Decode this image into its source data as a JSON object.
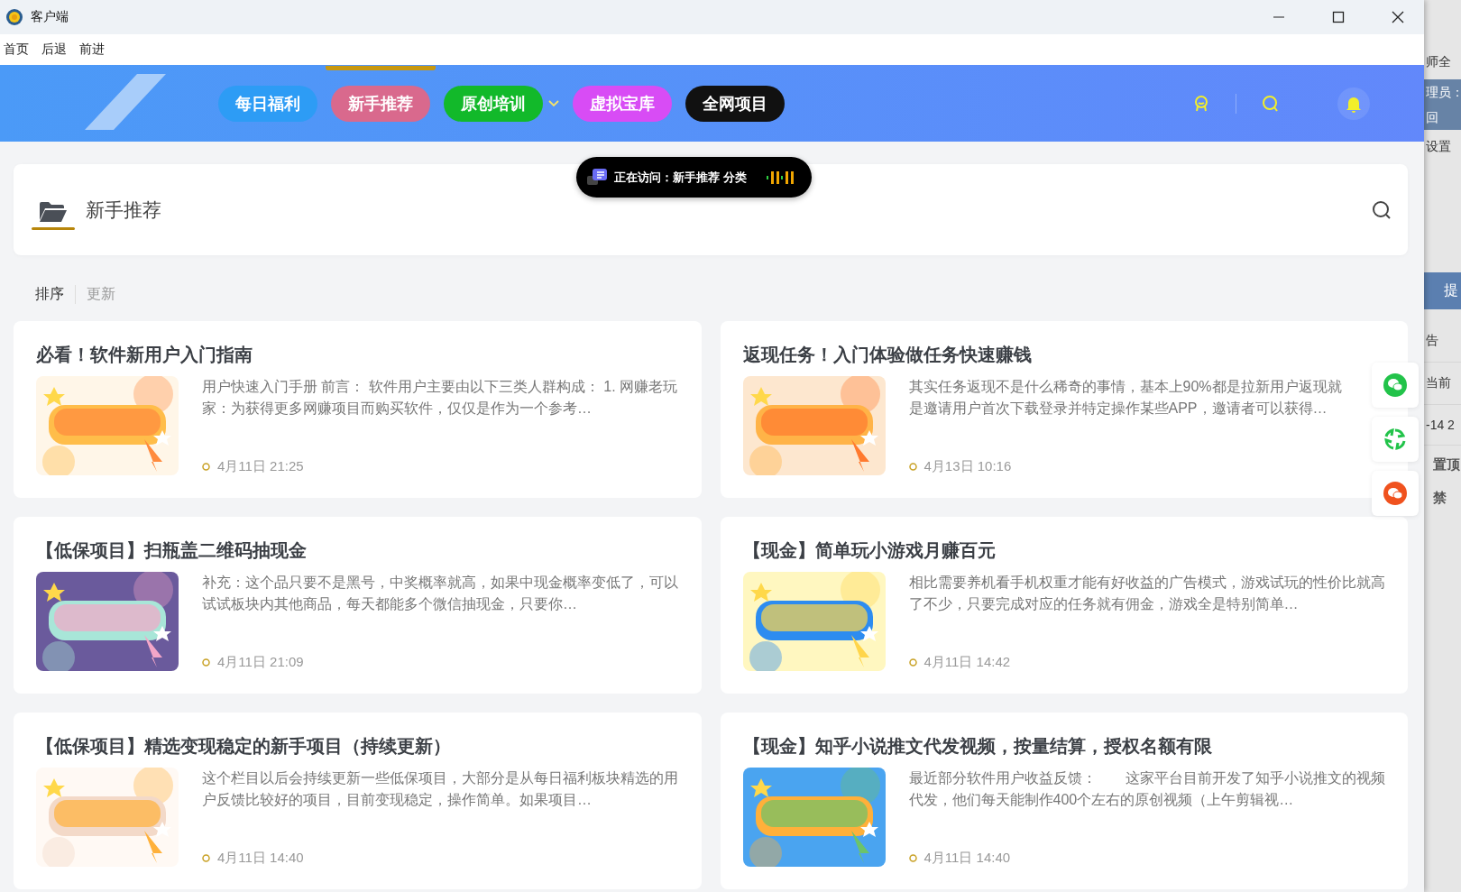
{
  "window": {
    "title": "客户端"
  },
  "menu": [
    "首页",
    "后退",
    "前进"
  ],
  "nav_tabs": [
    {
      "label": "每日福利",
      "selected": false,
      "color": "#2d9cf5",
      "has_dropdown": false
    },
    {
      "label": "新手推荐",
      "selected": true,
      "color": "#d9698d",
      "has_dropdown": false
    },
    {
      "label": "原创培训",
      "selected": false,
      "color": "#12b92a",
      "has_dropdown": true
    },
    {
      "label": "虚拟宝库",
      "selected": false,
      "color": "#d84cf5",
      "has_dropdown": false
    },
    {
      "label": "全网项目",
      "selected": false,
      "color": "#111111",
      "has_dropdown": false
    }
  ],
  "visit_badge": {
    "text": "正在访问：新手推荐 分类"
  },
  "category": {
    "title": "新手推荐"
  },
  "sort_bar": [
    {
      "label": "排序",
      "selected": true
    },
    {
      "label": "更新",
      "selected": false
    }
  ],
  "posts": [
    {
      "title": "必看！软件新用户入门指南",
      "excerpt": "用户快速入门手册 前言： 软件用户主要由以下三类人群构成： 1. 网赚老玩家：为获得更多网赚项目而购买软件，仅仅是作为一个参考…",
      "date": "4月11日 21:25"
    },
    {
      "title": "返现任务！入门体验做任务快速赚钱",
      "excerpt": "其实任务返现不是什么稀奇的事情，基本上90%都是拉新用户返现就是邀请用户首次下载登录并特定操作某些APP，邀请者可以获得…",
      "date": "4月13日 10:16"
    },
    {
      "title": "【低保项目】扫瓶盖二维码抽现金",
      "excerpt": "补充：这个品只要不是黑号，中奖概率就高，如果中现金概率变低了，可以试试板块内其他商品，每天都能多个微信抽现金，只要你…",
      "date": "4月11日 21:09"
    },
    {
      "title": "【现金】简单玩小游戏月赚百元",
      "excerpt": "相比需要养机看手机权重才能有好收益的广告模式，游戏试玩的性价比就高了不少，只要完成对应的任务就有佣金，游戏全是特别简单…",
      "date": "4月11日 14:42"
    },
    {
      "title": "【低保项目】精选变现稳定的新手项目（持续更新）",
      "excerpt": "这个栏目以后会持续更新一些低保项目，大部分是从每日福利板块精选的用户反馈比较好的项目，目前变现稳定，操作简单。如果项目…",
      "date": "4月11日 14:40"
    },
    {
      "title": "【现金】知乎小说推文代发视频，按量结算，授权名额有限",
      "excerpt": "最近部分软件用户收益反馈：　　这家平台目前开发了知乎小说推文的视频代发，他们每天能制作400个左右的原创视频（上午剪辑视…",
      "date": "4月11日 14:40"
    }
  ],
  "share_buttons": [
    {
      "kind": "wechat",
      "color": "#22c34a"
    },
    {
      "kind": "moments",
      "color": "#22c34a"
    },
    {
      "kind": "weibo",
      "color": "#f0521e"
    }
  ],
  "background_window": [
    {
      "text": "师全",
      "kind": "plain"
    },
    {
      "text": "理员：",
      "kind": "band"
    },
    {
      "text": "回",
      "kind": "band"
    },
    {
      "text": "设置",
      "kind": "plain"
    },
    {
      "text": "提",
      "kind": "button"
    },
    {
      "text": "告",
      "kind": "row"
    },
    {
      "text": "当前",
      "kind": "row"
    },
    {
      "text": "-14 2",
      "kind": "row"
    },
    {
      "text": "置顶",
      "kind": "bold"
    },
    {
      "text": "禁",
      "kind": "bold"
    }
  ]
}
